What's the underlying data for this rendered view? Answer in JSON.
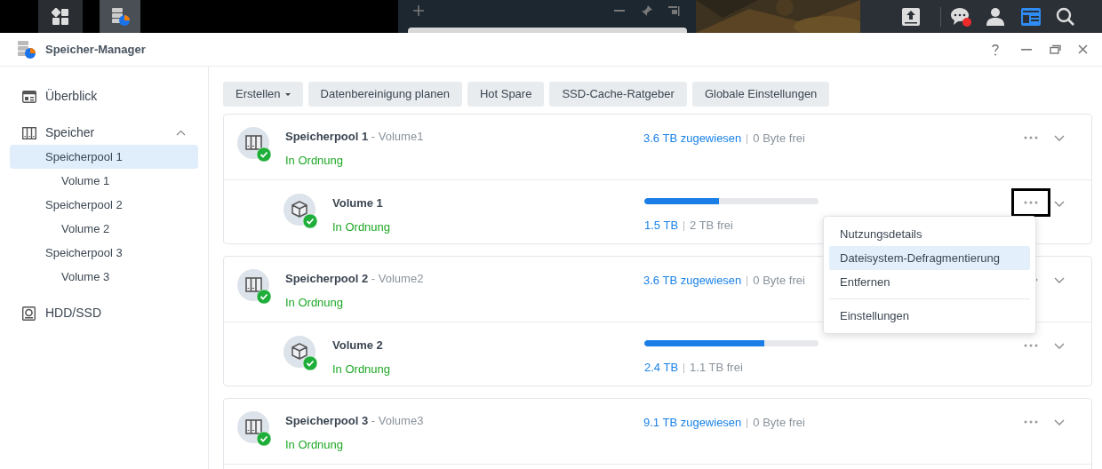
{
  "window": {
    "title": "Speicher-Manager"
  },
  "toolbar": {
    "buttons": [
      {
        "label": "Erstellen",
        "dropdown": true
      },
      {
        "label": "Datenbereinigung planen",
        "dropdown": false
      },
      {
        "label": "Hot Spare",
        "dropdown": false
      },
      {
        "label": "SSD-Cache-Ratgeber",
        "dropdown": false
      },
      {
        "label": "Globale Einstellungen",
        "dropdown": false
      }
    ]
  },
  "sidebar": {
    "items": [
      {
        "label": "Überblick",
        "selected": false
      },
      {
        "label": "Speicher",
        "selected": false,
        "expanded": true,
        "children": [
          {
            "label": "Speicherpool 1",
            "selected": true,
            "children": [
              {
                "label": "Volume 1",
                "selected": false
              }
            ]
          },
          {
            "label": "Speicherpool 2",
            "selected": false,
            "children": [
              {
                "label": "Volume 2",
                "selected": false
              }
            ]
          },
          {
            "label": "Speicherpool 3",
            "selected": false,
            "children": [
              {
                "label": "Volume 3",
                "selected": false
              }
            ]
          }
        ]
      },
      {
        "label": "HDD/SSD",
        "selected": false
      }
    ]
  },
  "pools": [
    {
      "name": "Speicherpool 1",
      "volume_label": "- Volume1",
      "status": "In Ordnung",
      "allocated": "3.6 TB zugewiesen",
      "free": "0 Byte frei",
      "volumes": [
        {
          "name": "Volume 1",
          "status": "In Ordnung",
          "level": 0.43,
          "used": "1.5 TB",
          "free": "2 TB frei",
          "menu_open": true
        }
      ]
    },
    {
      "name": "Speicherpool 2",
      "volume_label": "- Volume2",
      "status": "In Ordnung",
      "allocated": "3.6 TB zugewiesen",
      "free": "0 Byte frei",
      "volumes": [
        {
          "name": "Volume 2",
          "status": "In Ordnung",
          "level": 0.69,
          "used": "2.4 TB",
          "free": "1.1 TB frei",
          "menu_open": false
        }
      ]
    },
    {
      "name": "Speicherpool 3",
      "volume_label": "- Volume3",
      "status": "In Ordnung",
      "allocated": "9.1 TB zugewiesen",
      "free": "0 Byte frei"
    }
  ],
  "menu": {
    "items": [
      {
        "label": "Nutzungsdetails",
        "selected": false,
        "divider_before": false
      },
      {
        "label": "Dateisystem-Defragmentierung",
        "selected": true,
        "divider_before": false
      },
      {
        "label": "Entfernen",
        "selected": false,
        "divider_before": false
      },
      {
        "label": "Einstellungen",
        "selected": false,
        "divider_before": true
      }
    ]
  }
}
